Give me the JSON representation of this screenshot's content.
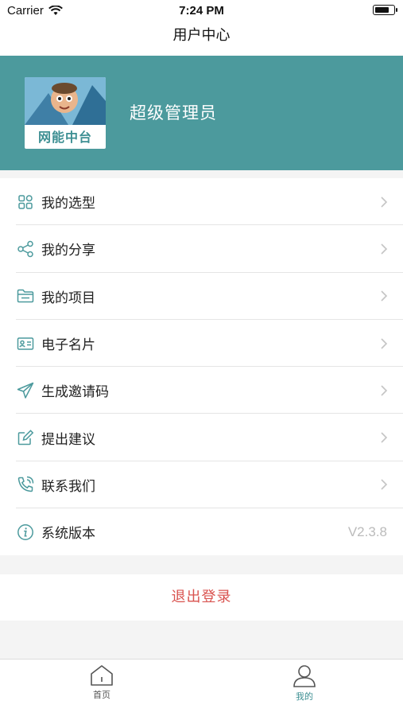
{
  "status_bar": {
    "carrier": "Carrier",
    "time": "7:24 PM"
  },
  "nav": {
    "title": "用户中心"
  },
  "profile": {
    "avatar_caption": "网能中台",
    "username": "超级管理员"
  },
  "menu": {
    "items": [
      {
        "label": "我的选型",
        "icon": "grid-icon"
      },
      {
        "label": "我的分享",
        "icon": "share-icon"
      },
      {
        "label": "我的项目",
        "icon": "folder-icon"
      },
      {
        "label": "电子名片",
        "icon": "id-card-icon"
      },
      {
        "label": "生成邀请码",
        "icon": "paper-plane-icon"
      },
      {
        "label": "提出建议",
        "icon": "edit-icon"
      },
      {
        "label": "联系我们",
        "icon": "phone-icon"
      },
      {
        "label": "系统版本",
        "icon": "info-icon",
        "value": "V2.3.8"
      }
    ]
  },
  "logout": {
    "label": "退出登录"
  },
  "tabs": [
    {
      "label": "首页",
      "icon": "home-icon",
      "active": false
    },
    {
      "label": "我的",
      "icon": "user-icon",
      "active": true
    }
  ],
  "colors": {
    "accent": "#4c9a9d",
    "logout": "#d9534f",
    "tab_active": "#3d8f93",
    "icon": "#4c9a9d"
  }
}
